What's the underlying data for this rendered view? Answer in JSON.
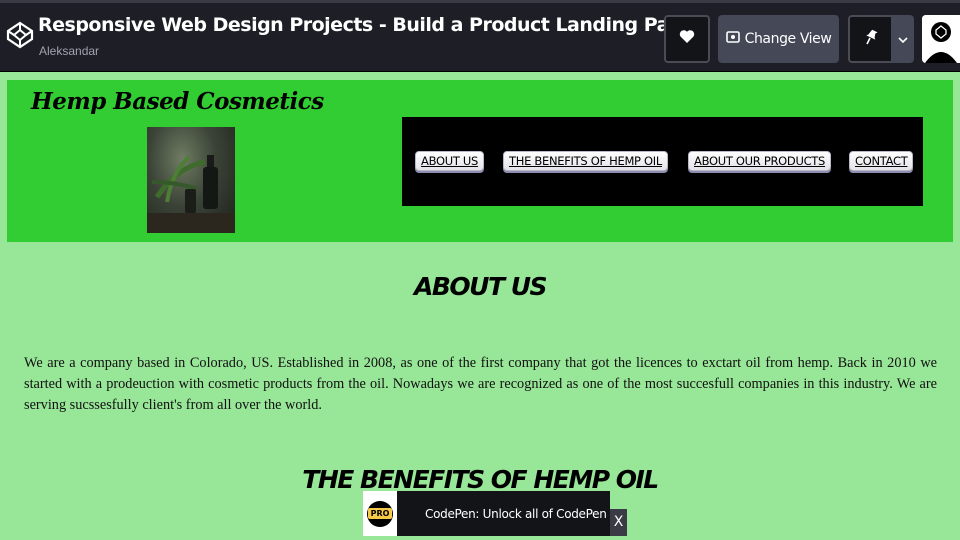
{
  "topbar": {
    "title": "Responsive Web Design Projects - Build a Product Landing Page",
    "author": "Aleksandar",
    "logo_icon": "codepen-logo-icon",
    "heart_icon": "heart-icon",
    "change_view_label": "Change View",
    "change_view_icon": "layout-icon",
    "pin_icon": "pin-icon",
    "caret_icon": "chevron-down-icon",
    "avatar_icon": "user-avatar-icon"
  },
  "site": {
    "brand": "Hemp Based Cosmetics",
    "image_alt": "hemp oil bottles with hemp leaves",
    "nav": [
      {
        "label": "ABOUT US"
      },
      {
        "label": "THE BENEFITS OF HEMP OIL"
      },
      {
        "label": "ABOUT OUR PRODUCTS"
      },
      {
        "label": "CONTACT"
      }
    ],
    "about_heading": "ABOUT US",
    "about_text": "We are a company based in Colorado, US. Established in 2008, as one of the first company that got the licences to exctart oil from hemp. Back in 2010 we started with a prodeuction with cosmetic products from the oil. Nowadays we are recognized as one of the most succesfull companies in this industry. We are serving sucssesfully client's from all over the world.",
    "benefits_heading": "THE BENEFITS OF HEMP OIL"
  },
  "promo": {
    "badge": "PRO",
    "text": "CodePen: Unlock all of CodePen",
    "close": "X"
  },
  "colors": {
    "topbar_bg": "#1e1f26",
    "header_green": "#32cd32",
    "page_bg": "#98e698",
    "nav_bg": "#000000"
  }
}
